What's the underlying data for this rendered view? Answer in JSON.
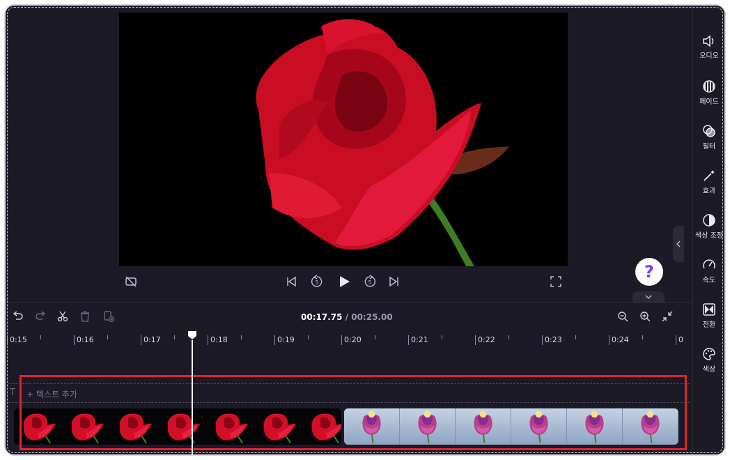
{
  "colors": {
    "bg": "#1b1a26",
    "highlight": "#e0242a",
    "accent": "#7a3df0"
  },
  "player": {
    "hide_icon": "eye-off-icon",
    "skip_back_icon": "skip-start-icon",
    "rewind_label": "5",
    "play_icon": "play-icon",
    "forward_label": "5",
    "skip_end_icon": "skip-end-icon",
    "fullscreen_icon": "fullscreen-icon"
  },
  "help": {
    "label": "?"
  },
  "sidebar": {
    "items": [
      {
        "label": "오디오",
        "icon": "speaker-icon"
      },
      {
        "label": "페이드",
        "icon": "fade-icon"
      },
      {
        "label": "필터",
        "icon": "filter-icon"
      },
      {
        "label": "효과",
        "icon": "magic-wand-icon"
      },
      {
        "label": "색상 조정",
        "icon": "contrast-icon"
      },
      {
        "label": "속도",
        "icon": "speedometer-icon"
      },
      {
        "label": "전환",
        "icon": "transition-icon"
      },
      {
        "label": "색상",
        "icon": "palette-icon"
      }
    ]
  },
  "toolbar": {
    "current_time": "00:17.75",
    "separator": " / ",
    "total_time": "00:25.00"
  },
  "ruler": {
    "labels": [
      "0:15",
      "0:16",
      "0:17",
      "0:18",
      "0:19",
      "0:20",
      "0:21",
      "0:22",
      "0:23",
      "0:24",
      "0"
    ]
  },
  "text_track": {
    "icon_label": "T",
    "add_label": "+ 텍스트 추가"
  },
  "clips": {
    "clip1": {
      "thumbnail_count": 7
    },
    "clip2": {
      "thumbnail_count": 6
    }
  }
}
